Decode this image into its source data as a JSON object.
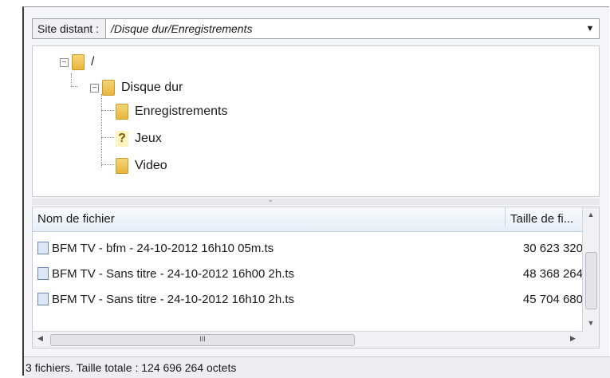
{
  "path_bar": {
    "label": "Site distant :",
    "value": "/Disque dur/Enregistrements"
  },
  "tree": {
    "root": "/",
    "disk": "Disque dur",
    "children": [
      "Enregistrements",
      "Jeux",
      "Video"
    ]
  },
  "file_list": {
    "columns": [
      "Nom de fichier",
      "Taille de fi..."
    ],
    "rows": [
      {
        "name": "BFM TV - bfm - 24-10-2012 16h10 05m.ts",
        "size": "30 623 320"
      },
      {
        "name": "BFM TV - Sans titre - 24-10-2012 16h00 2h.ts",
        "size": "48 368 264"
      },
      {
        "name": "BFM TV - Sans titre - 24-10-2012 16h10 2h.ts",
        "size": "45 704 680"
      }
    ],
    "hscroll_grip": "III"
  },
  "status": "3 fichiers. Taille totale : 124 696 264 octets"
}
